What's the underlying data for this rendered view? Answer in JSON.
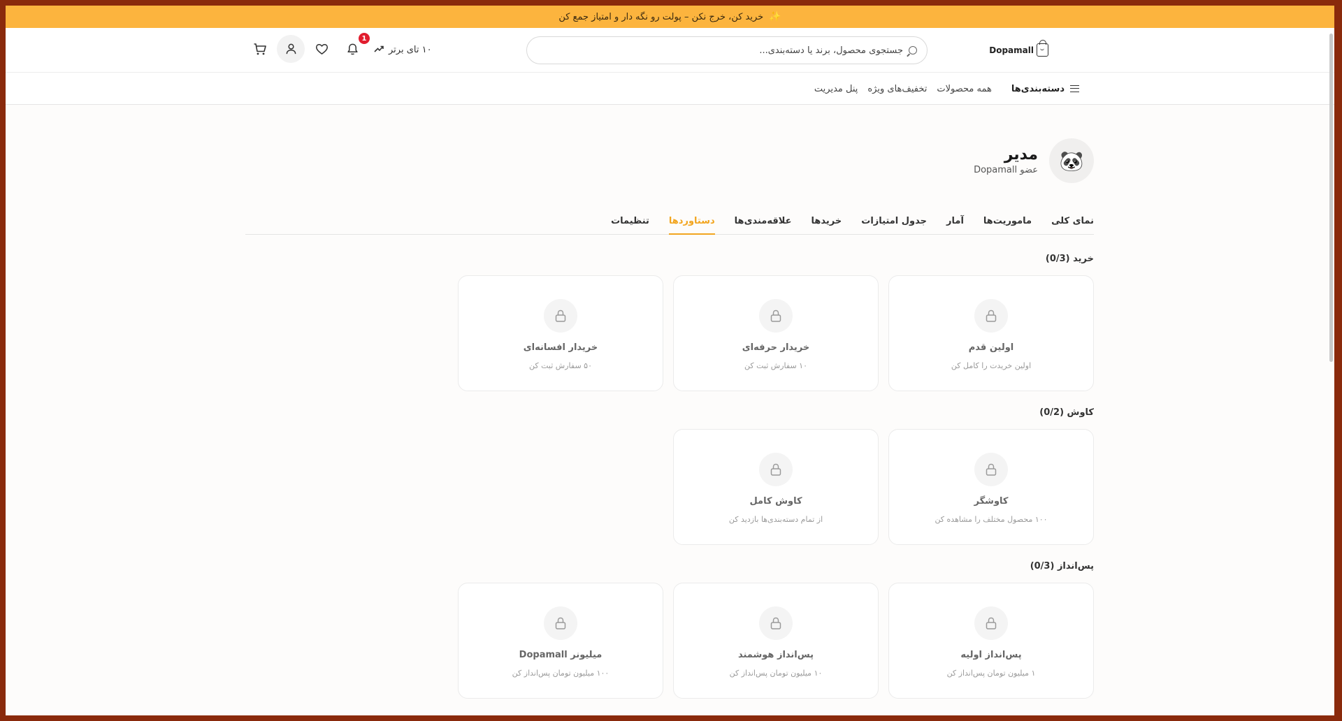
{
  "banner": {
    "text": "خرید کن، خرج نکن – پولت رو نگه دار و امتیاز جمع کن"
  },
  "header": {
    "logo": "Dopamall",
    "search_placeholder": "جستجوی محصول، برند یا دسته‌بندی...",
    "top10": "۱۰ تای برتر",
    "notification_count": "1"
  },
  "nav": {
    "categories": "دسته‌بندی‌ها",
    "links": [
      "همه محصولات",
      "تخفیف‌های ویژه",
      "پنل مدیریت"
    ]
  },
  "profile": {
    "avatar": "🐼",
    "name": "مدیر",
    "subtitle": "عضو Dopamall"
  },
  "tabs": [
    "نمای کلی",
    "ماموریت‌ها",
    "آمار",
    "جدول امتیازات",
    "خریدها",
    "علاقه‌مندی‌ها",
    "دستاوردها",
    "تنظیمات"
  ],
  "active_tab": "دستاوردها",
  "sections": [
    {
      "title": "خرید (0/3)",
      "cards": [
        {
          "title": "اولین قدم",
          "desc": "اولین خریدت را کامل کن"
        },
        {
          "title": "خریدار حرفه‌ای",
          "desc": "۱۰ سفارش ثبت کن"
        },
        {
          "title": "خریدار افسانه‌ای",
          "desc": "۵۰ سفارش ثبت کن"
        }
      ]
    },
    {
      "title": "کاوش (0/2)",
      "cards": [
        {
          "title": "کاوشگر",
          "desc": "۱۰۰ محصول مختلف را مشاهده کن"
        },
        {
          "title": "کاوش کامل",
          "desc": "از تمام دسته‌بندی‌ها بازدید کن"
        }
      ]
    },
    {
      "title": "پس‌انداز (0/3)",
      "cards": [
        {
          "title": "پس‌انداز اولیه",
          "desc": "۱ میلیون تومان پس‌انداز کن"
        },
        {
          "title": "پس‌انداز هوشمند",
          "desc": "۱۰ میلیون تومان پس‌انداز کن"
        },
        {
          "title": "میلیونر Dopamall",
          "desc": "۱۰۰ میلیون تومان پس‌انداز کن"
        }
      ]
    }
  ]
}
